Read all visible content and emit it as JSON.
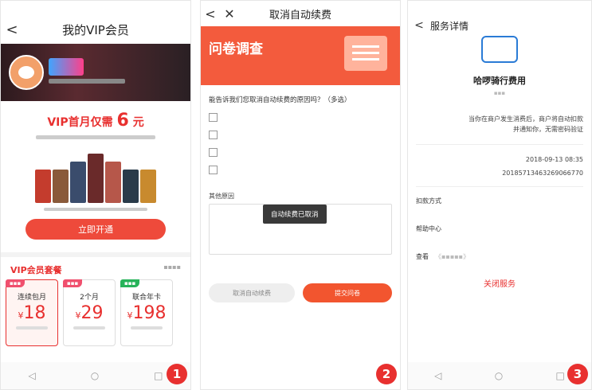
{
  "steps": [
    "1",
    "2",
    "3"
  ],
  "p1": {
    "title": "我的VIP会员",
    "promo_prefix": "VIP首月仅需",
    "promo_big": "6",
    "promo_suffix": "元",
    "open_button": "立即开通",
    "packages_title": "VIP会员套餐",
    "packages": [
      {
        "name": "连续包月",
        "price": "18",
        "tag_color": "#f0506e",
        "selected": true
      },
      {
        "name": "2个月",
        "price": "29",
        "tag_color": "#f0506e",
        "selected": false
      },
      {
        "name": "联合年卡",
        "price": "198",
        "tag_color": "#27b35a",
        "selected": false
      }
    ],
    "currency": "¥",
    "poster_colors": [
      "#c43c2d",
      "#8a5a3a",
      "#3a4c6c",
      "#6a2a2a",
      "#b6574a",
      "#2a3b4a",
      "#c88a2e"
    ],
    "nav_icons": [
      "◁",
      "○",
      "□"
    ]
  },
  "p2": {
    "back": "<",
    "close": "✕",
    "title": "取消自动续费",
    "banner_title": "问卷调查",
    "question": "能告诉我们您取消自动续费的原因吗？（多选）",
    "other_label": "其他原因",
    "toast": "自动续费已取消",
    "cancel_button": "取消自动续费",
    "submit_button": "提交问卷"
  },
  "p3": {
    "back": "<",
    "title": "服务详情",
    "app_name": "哈啰骑行费用",
    "desc_value": "当你在商户发生消费后，商户将自动扣款并通知你，无需密码验证",
    "open_time": "2018-09-13 08:35",
    "agreement_no": "20185713463269066770",
    "deduct_label": "扣款方式",
    "help_label": "帮助中心",
    "view_label": "查看",
    "close_service": "关闭服务",
    "nav_icons": [
      "◁",
      "○",
      "□"
    ]
  }
}
